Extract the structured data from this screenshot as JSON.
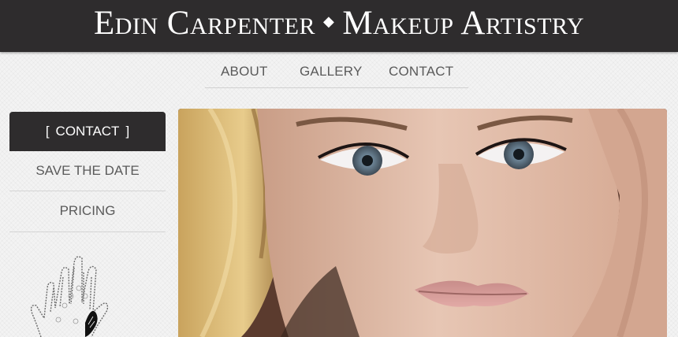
{
  "header": {
    "title_left": "Edin Carpenter",
    "separator": "◆",
    "title_right": "Makeup Artistry"
  },
  "topnav": {
    "items": [
      {
        "label": "ABOUT"
      },
      {
        "label": "GALLERY"
      },
      {
        "label": "CONTACT"
      }
    ]
  },
  "sidebar": {
    "active": {
      "bracket_left": "[",
      "label": "CONTACT",
      "bracket_right": "]"
    },
    "items": [
      {
        "label": "SAVE THE DATE"
      },
      {
        "label": "PRICING"
      }
    ]
  },
  "colors": {
    "header_bg": "#2e2c2d",
    "page_bg": "#f3f3f3",
    "nav_text": "#5a5a5a",
    "active_text": "#ffffff"
  },
  "images": {
    "hand_icon": "lace-hand-illustration",
    "hero": "model-face-portrait"
  }
}
